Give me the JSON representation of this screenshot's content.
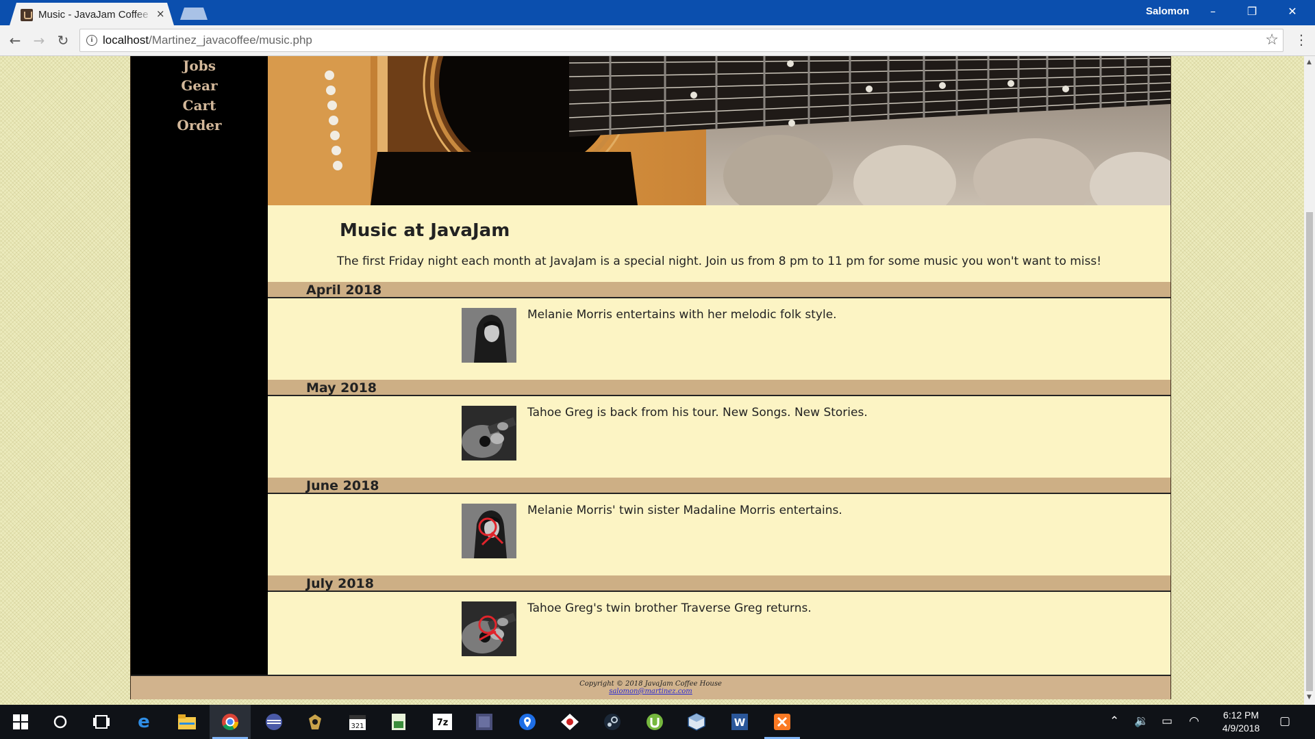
{
  "browser": {
    "tab_title": "Music - JavaJam Coffee House",
    "tab_close": "×",
    "profile_name": "Salomon",
    "minimize": "–",
    "restore": "❐",
    "close": "✕",
    "back": "←",
    "forward": "→",
    "reload": "↻",
    "url_host": "localhost",
    "url_path": "/Martinez_javacoffee/music.php",
    "star": "☆",
    "menu": "⋮"
  },
  "page": {
    "nav": [
      "Jobs",
      "Gear",
      "Cart",
      "Order"
    ],
    "title": "Music at JavaJam",
    "intro": "The first Friday night each month at JavaJam is a special night. Join us from 8 pm to 11 pm for some music you won't want to miss!",
    "events": [
      {
        "month": "April 2018",
        "text": "Melanie Morris entertains with her melodic folk style."
      },
      {
        "month": "May 2018",
        "text": "Tahoe Greg is back from his tour. New Songs. New Stories."
      },
      {
        "month": "June 2018",
        "text": "Melanie Morris' twin sister Madaline Morris entertains."
      },
      {
        "month": "July 2018",
        "text": "Tahoe Greg's twin brother Traverse Greg returns."
      }
    ],
    "footer": {
      "copyright": "Copyright © 2018 JavaJam Coffee House",
      "email": "salomon@martinez.com"
    }
  },
  "taskbar": {
    "time": "6:12 PM",
    "date": "4/9/2018",
    "apps": [
      "start-icon",
      "search-icon",
      "task-view-icon",
      "edge-icon",
      "file-explorer-icon",
      "chrome-icon",
      "media-icon",
      "app-icon",
      "calendar-icon",
      "spreadsheet-icon",
      "7zip-icon",
      "image-icon",
      "maps-icon",
      "spider-icon",
      "steam-icon",
      "utorrent-icon",
      "virtualbox-icon",
      "word-icon",
      "xampp-icon"
    ]
  },
  "colors": {
    "nav_text": "#d3b89a",
    "month_band": "#cdaf85",
    "content_bg": "#fcf4c4",
    "footer_bg": "#d1b38d"
  }
}
